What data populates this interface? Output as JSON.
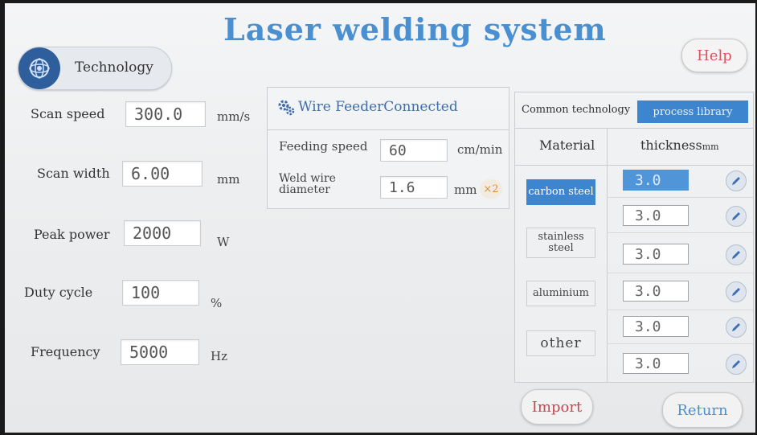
{
  "header": {
    "title": "Laser welding system",
    "tab_label": "Technology",
    "help_label": "Help"
  },
  "params": [
    {
      "label": "Scan speed",
      "value": "300.0",
      "unit": "mm/s"
    },
    {
      "label": "Scan width",
      "value": "6.00",
      "unit": "mm"
    },
    {
      "label": "Peak power",
      "value": "2000",
      "unit": "W"
    },
    {
      "label": "Duty cycle",
      "value": "100",
      "unit": "%"
    },
    {
      "label": "Frequency",
      "value": "5000",
      "unit": "Hz"
    }
  ],
  "wire_feeder": {
    "title": "Wire FeederConnected",
    "feeding_speed_label": "Feeding speed",
    "feeding_speed_value": "60",
    "feeding_speed_unit": "cm/min",
    "diameter_label_1": "Weld wire",
    "diameter_label_2": "diameter",
    "diameter_value": "1.6",
    "diameter_unit": "mm",
    "multiplier": "×2"
  },
  "library": {
    "tab_common": "Common technology",
    "tab_process": "process library",
    "col_material": "Material",
    "col_thickness": "thickness",
    "col_thickness_unit": "mm",
    "materials": [
      "carbon steel",
      "stainless steel",
      "aluminium",
      "other"
    ],
    "thickness_values": [
      "3.0",
      "3.0",
      "3.0",
      "3.0",
      "3.0",
      "3.0"
    ]
  },
  "footer": {
    "import_label": "Import",
    "return_label": "Return"
  },
  "colors": {
    "accent_blue": "#3d86cf",
    "title_blue": "#4a8fd0",
    "warn_red": "#c94650"
  },
  "icons": {
    "technology": "technology-icon",
    "wire_feeder": "gear-icon",
    "edit": "edit-icon"
  }
}
